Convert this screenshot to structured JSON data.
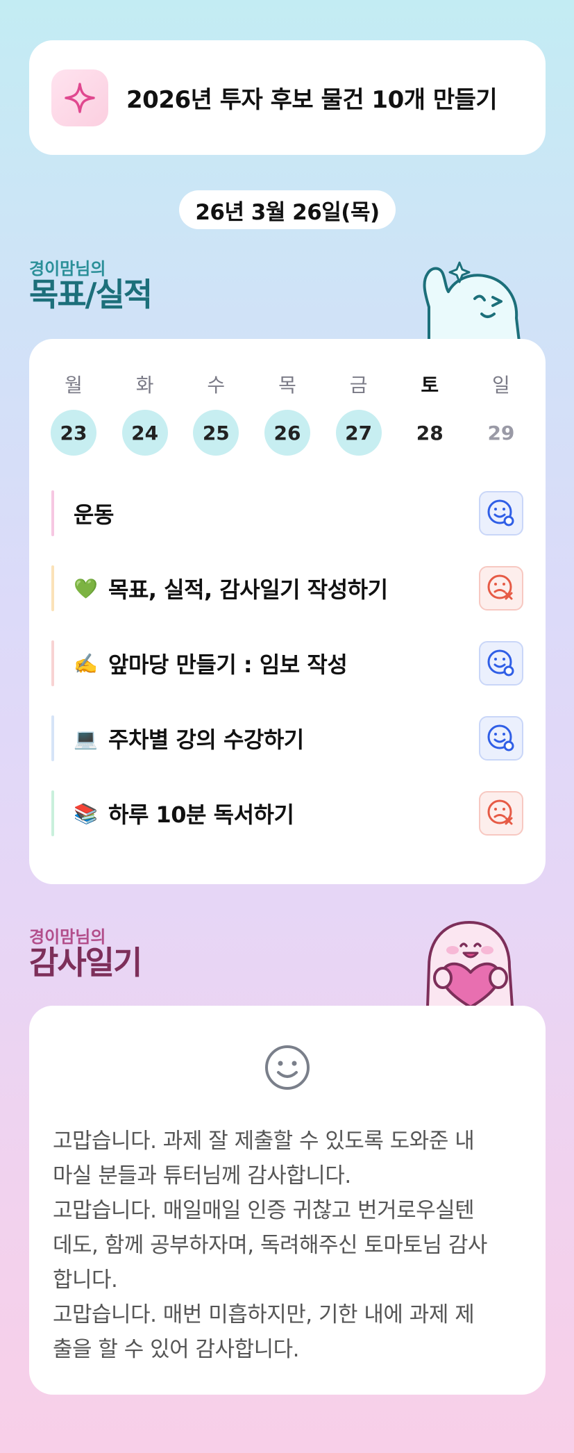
{
  "goal": {
    "text": "2026년 투자 후보 물건 10개 만들기",
    "icon": "sparkle-icon"
  },
  "date": "26년 3월 26일(목)",
  "goals_section": {
    "owner": "경이맘님의",
    "title": "목표/실적"
  },
  "week": [
    {
      "name": "월",
      "num": "23",
      "state": "done"
    },
    {
      "name": "화",
      "num": "24",
      "state": "done"
    },
    {
      "name": "수",
      "num": "25",
      "state": "done"
    },
    {
      "name": "목",
      "num": "26",
      "state": "done"
    },
    {
      "name": "금",
      "num": "27",
      "state": "done"
    },
    {
      "name": "토",
      "num": "28",
      "state": "today"
    },
    {
      "name": "일",
      "num": "29",
      "state": "future"
    }
  ],
  "tasks": [
    {
      "emoji": "",
      "label": "운동",
      "status": "done",
      "bar_color": "#f6c7e2"
    },
    {
      "emoji": "💚",
      "label": "목표, 실적, 감사일기 작성하기",
      "status": "missed",
      "bar_color": "#fbe2b8"
    },
    {
      "emoji": "✍️",
      "label": "앞마당 만들기 : 임보 작성",
      "status": "done",
      "bar_color": "#f8d3d3"
    },
    {
      "emoji": "💻",
      "label": "주차별 강의 수강하기",
      "status": "done",
      "bar_color": "#d6e4f7"
    },
    {
      "emoji": "📚",
      "label": "하루 10분 독서하기",
      "status": "missed",
      "bar_color": "#c9f0dc"
    }
  ],
  "gratitude_section": {
    "owner": "경이맘님의",
    "title": "감사일기",
    "mood_icon": "smiley-face-icon"
  },
  "gratitude_lines": [
    "고맙습니다. 과제 잘 제출할 수 있도록 도와준 내",
    "마실 분들과 튜터님께 감사합니다.",
    "고맙습니다. 매일매일 인증 귀찮고 번거로우실텐",
    "데도, 함께 공부하자며, 독려해주신 토마토님 감사",
    "합니다.",
    "고맙습니다. 매번 미흡하지만, 기한 내에 과제 제",
    "출을 할 수 있어 감사합니다."
  ],
  "colors": {
    "done_day": "#c7eef1",
    "status_ok": "#2f5ee6",
    "status_fail": "#e65a45",
    "teal_title": "#1c6f7a",
    "berry_title": "#7d2f5a"
  }
}
